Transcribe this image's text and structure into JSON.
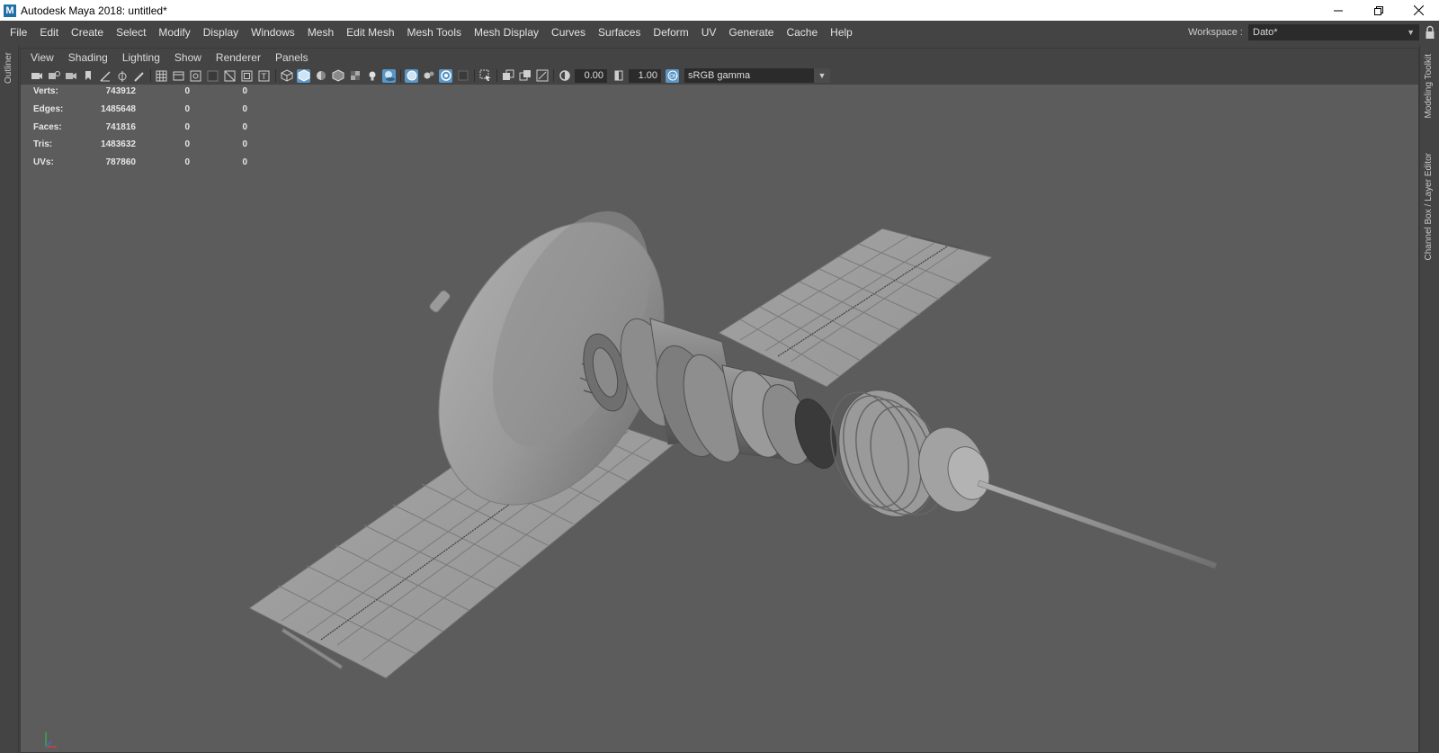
{
  "window": {
    "title": "Autodesk Maya 2018: untitled*",
    "app_icon": "M",
    "controls": [
      "minimize-icon",
      "restore-icon",
      "close-icon"
    ]
  },
  "menubar": {
    "items": [
      "File",
      "Edit",
      "Create",
      "Select",
      "Modify",
      "Display",
      "Windows",
      "Mesh",
      "Edit Mesh",
      "Mesh Tools",
      "Mesh Display",
      "Curves",
      "Surfaces",
      "Deform",
      "UV",
      "Generate",
      "Cache",
      "Help"
    ],
    "workspace_label": "Workspace :",
    "workspace_value": "Dato*"
  },
  "side_tabs": {
    "left": "Outliner",
    "right_top": "Modeling Toolkit",
    "right_bottom": "Channel Box / Layer Editor"
  },
  "panel": {
    "menus": [
      "View",
      "Shading",
      "Lighting",
      "Show",
      "Renderer",
      "Panels"
    ],
    "toolbar": {
      "exposure": "0.00",
      "gamma": "1.00",
      "color_space": "sRGB gamma"
    }
  },
  "hud": {
    "rows": [
      {
        "label": "Verts:",
        "v1": "743912",
        "v2": "0",
        "v3": "0"
      },
      {
        "label": "Edges:",
        "v1": "1485648",
        "v2": "0",
        "v3": "0"
      },
      {
        "label": "Faces:",
        "v1": "741816",
        "v2": "0",
        "v3": "0"
      },
      {
        "label": "Tris:",
        "v1": "1483632",
        "v2": "0",
        "v3": "0"
      },
      {
        "label": "UVs:",
        "v1": "787860",
        "v2": "0",
        "v3": "0"
      }
    ]
  },
  "colors": {
    "viewport_bg": "#5c5c5c",
    "ui_bg": "#444444",
    "highlight": "#5aa0d0"
  }
}
